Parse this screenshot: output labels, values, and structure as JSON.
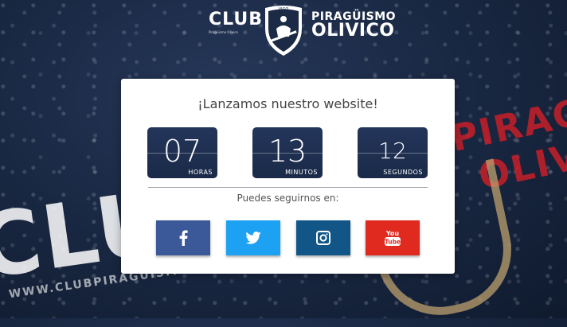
{
  "header": {
    "club_label": "CLUB",
    "tagline": "Piragüismo Olivico",
    "crest_label": "VIGO",
    "brand_line1": "PIRAGÜISMO",
    "brand_line2": "OLIVICO"
  },
  "background": {
    "club_text": "CLUB",
    "pira_text": "PIRAG",
    "oli_text": "OLIVI",
    "url_text": "WWW.CLUBPIRAGUISMO..."
  },
  "card": {
    "title": "¡Lanzamos nuestro website!",
    "countdown": [
      {
        "value": "07",
        "unit": "HORAS"
      },
      {
        "value": "13",
        "unit": "MINUTOS"
      },
      {
        "value": "12",
        "unit": "SEGUNDOS"
      }
    ],
    "follow_text": "Puedes seguirnos en:",
    "social": [
      {
        "name": "facebook",
        "icon": "facebook-icon",
        "color": "#3b5998"
      },
      {
        "name": "twitter",
        "icon": "twitter-icon",
        "color": "#1da1f2"
      },
      {
        "name": "instagram",
        "icon": "instagram-icon",
        "color": "#125688"
      },
      {
        "name": "youtube",
        "icon": "youtube-icon",
        "color": "#e02a20",
        "icon_text_1": "You",
        "icon_text_2": "Tube"
      }
    ]
  },
  "colors": {
    "background": "#1a2944",
    "timer": "#1e2f50"
  }
}
